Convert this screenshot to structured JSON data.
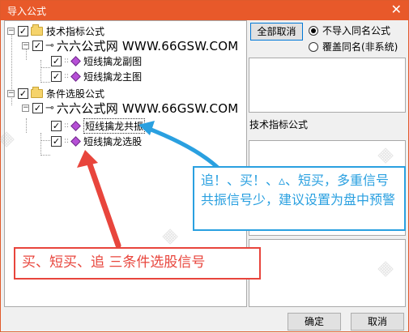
{
  "window": {
    "title": "导入公式",
    "close_glyph": "✕"
  },
  "tree": {
    "expand_minus": "−",
    "check": "✓",
    "key": "⊸",
    "groups": [
      {
        "label": "技术指标公式",
        "source": "六六公式网 WWW.66GSW.COM",
        "items": [
          "短线擒龙副图",
          "短线擒龙主图"
        ]
      },
      {
        "label": "条件选股公式",
        "source": "六六公式网 WWW.66GSW.COM",
        "items": [
          "短线擒龙共振",
          "短线擒龙选股"
        ]
      }
    ]
  },
  "controls": {
    "cancel_all": "全部取消",
    "radio_no_import": "不导入同名公式",
    "radio_overwrite": "覆盖同名(非系统)",
    "panel_title": "技术指标公式",
    "ok": "确定",
    "cancel": "取消"
  },
  "callouts": {
    "blue": "追！、买！、▵、短买，多重信号共振信号少，建议设置为盘中预警",
    "red": "买、短买、追 三条件选股信号"
  },
  "colors": {
    "titlebar": "#e8592a",
    "blue": "#2aa0e0",
    "red": "#e8453c"
  }
}
